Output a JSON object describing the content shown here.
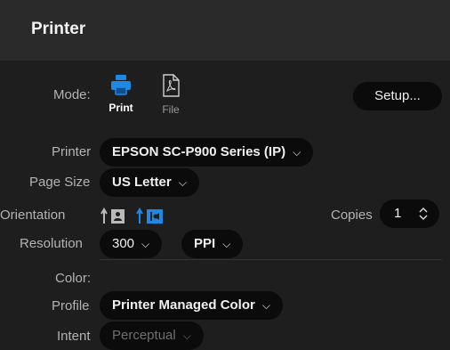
{
  "panel": {
    "title": "Printer"
  },
  "mode": {
    "label": "Mode:",
    "options": [
      {
        "label": "Print",
        "icon": "printer-icon",
        "active": true
      },
      {
        "label": "File",
        "icon": "pdf-file-icon",
        "active": false
      }
    ],
    "setup_label": "Setup..."
  },
  "printer": {
    "label": "Printer",
    "value": "EPSON SC-P900 Series (IP)"
  },
  "page_size": {
    "label": "Page Size",
    "value": "US Letter"
  },
  "orientation": {
    "label": "Orientation",
    "options": [
      "portrait-icon",
      "landscape-icon"
    ],
    "selected": "landscape-icon"
  },
  "copies": {
    "label": "Copies",
    "value": "1"
  },
  "resolution": {
    "label": "Resolution",
    "value": "300",
    "unit": "PPI"
  },
  "color": {
    "section_label": "Color:",
    "profile_label": "Profile",
    "profile_value": "Printer Managed Color",
    "intent_label": "Intent",
    "intent_value": "Perceptual"
  },
  "colors": {
    "accent": "#1e88e5",
    "background": "#1e1e1e",
    "header": "#2a2a2a",
    "pill": "#0b0b0b"
  }
}
